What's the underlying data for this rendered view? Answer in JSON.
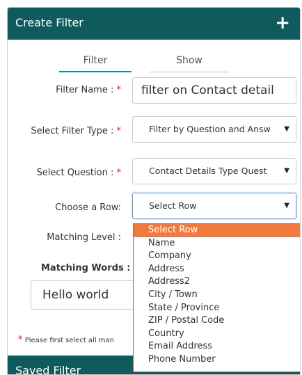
{
  "header": {
    "title": "Create Filter",
    "add_icon": "plus-icon"
  },
  "tabs": {
    "filter": "Filter",
    "show": "Show"
  },
  "form": {
    "filter_name": {
      "label": "Filter Name :",
      "required": "*",
      "value": "filter on Contact  detail"
    },
    "filter_type": {
      "label": "Select Filter Type :",
      "required": "*",
      "value": "Filter by Question and Answ"
    },
    "question": {
      "label": "Select Question :",
      "required": "*",
      "value": "Contact Details Type Quest"
    },
    "row": {
      "label": "Choose a Row:",
      "value": "Select Row"
    },
    "matching_level": {
      "label": "Matching Level :"
    },
    "matching_words": {
      "label": "Matching Words :",
      "value": "Hello world"
    }
  },
  "row_options": [
    "Select Row",
    "Name",
    "Company",
    "Address",
    "Address2",
    "City / Town",
    "State / Province",
    "ZIP / Postal Code",
    "Country",
    "Email Address",
    "Phone Number"
  ],
  "row_selected_index": 0,
  "note": {
    "required": "*",
    "text": "Please first select all man"
  },
  "saved": {
    "title": "Saved Filter"
  },
  "colors": {
    "header_bg": "#0e5a5d",
    "tab_accent": "#0e8c96",
    "required": "#e0163c",
    "option_highlight": "#f27a3f"
  }
}
